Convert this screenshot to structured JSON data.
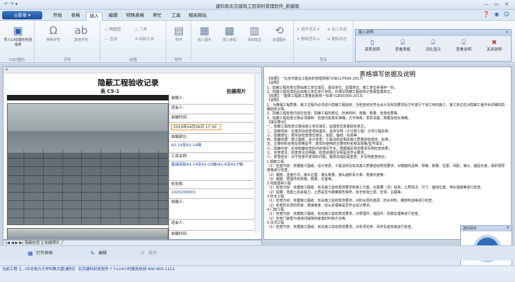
{
  "window": {
    "title": "建科助北京建筑工程资料管理软件_新建版",
    "qat": "↶ ↷ ▾",
    "controls": "— ▭ ✕"
  },
  "menu": {
    "app_button": "◎菜单 ▾",
    "tabs": [
      "开始",
      "表格",
      "插入",
      "编辑",
      "特殊表格",
      "帮忙",
      "工具",
      "相关网站"
    ],
    "active_tab": "插入",
    "help_icons": "❓ ◉ ☺"
  },
  "ribbon": {
    "groups": [
      {
        "label": "CAD图形",
        "buttons": [
          {
            "icon": "cad-icon",
            "glyph": "▣",
            "label": "导入CAD图形检验报表"
          }
        ]
      },
      {
        "label": "字符",
        "buttons": [
          {
            "icon": "omega-icon",
            "glyph": "Ω",
            "label": "特殊字符"
          },
          {
            "icon": "abc-icon",
            "glyph": "ab",
            "label": "其他字符"
          }
        ]
      },
      {
        "label": "绘图",
        "small": [
          "○ 椭圆圆",
          "△ 三角",
          "— 直线",
          "A 绘制文本"
        ]
      },
      {
        "label": "附件",
        "buttons": [
          {
            "icon": "attach-icon",
            "glyph": "▤",
            "label": "附件"
          }
        ]
      },
      {
        "label": "",
        "buttons": [
          {
            "icon": "image-icon",
            "glyph": "▦",
            "label": "插入图片"
          },
          {
            "icon": "qr-icon",
            "glyph": "▩",
            "label": "插入条码"
          },
          {
            "icon": "barcode-icon",
            "glyph": "▥",
            "label": "添加批注"
          },
          {
            "icon": "process-icon",
            "glyph": "⟲",
            "label": "处理图片"
          }
        ]
      },
      {
        "label": "签名",
        "small": [
          "✕ 插件签名 ▾",
          "⊕ 加工状态",
          "✕ 删除签名 ▾",
          "⊖ 删除状态"
        ]
      }
    ]
  },
  "popup_panel": {
    "title": "插入说明",
    "close": "✕",
    "buttons": [
      {
        "icon": "form-icon",
        "glyph": "▯",
        "label": "该表说明"
      },
      {
        "icon": "list-icon",
        "glyph": "⌸",
        "label": "查看表格"
      },
      {
        "icon": "compare-icon",
        "glyph": "⌸",
        "label": "对比显示"
      },
      {
        "icon": "note-icon",
        "glyph": "⌸",
        "label": "查看说明"
      },
      {
        "icon": "close-note-icon",
        "glyph": "✖",
        "label": "关闭说明"
      }
    ]
  },
  "sheet": {
    "row_header": "A",
    "title": "隐蔽工程验收记录",
    "subtitle": "表 C5-1",
    "right_label": "拍摄照片",
    "form_rows": [
      {
        "label": "拍摄人:",
        "value": ""
      },
      {
        "label": "班会人:",
        "value": ""
      },
      {
        "label": "拍摄时间:",
        "value": ""
      },
      {
        "label": "",
        "value": "2019年04月06日  17:30"
      },
      {
        "label": "拍摄部位:",
        "value": ""
      },
      {
        "label": "",
        "value": "A1-14至A1-19轴"
      },
      {
        "label": "工序名称:",
        "value": ""
      },
      {
        "label": "",
        "value": "基础底板A1-14至A1-19轴/A1-A至A1-F轴"
      },
      {
        "label": "检验批:",
        "value": ""
      },
      {
        "label": "",
        "value": "1020206001"
      },
      {
        "label": "拍摄人:",
        "value": ""
      },
      {
        "label": "班会人:",
        "value": ""
      },
      {
        "label": "拍摄时间:",
        "value": ""
      }
    ],
    "sheet_tabs": "|◀ ◀ ▶ ▶| 隐蔽检查 ╳  拍摄照片 ╱"
  },
  "guide": {
    "title": "表格填写依据及说明",
    "lines": [
      "【依据】：\"北京市建设工程资料管理规程\"(DB11/T695-2017)",
      "【说明】",
      "1、隐蔽工程检查记录由施工单位填写，建设单位、监理单位、施工单位各保存一份；",
      "2、隐蔽工程完成后应由施工单位进行自检，并填写隐蔽工程验收记录报监理单位；",
      "【依据】：\"建筑工程施工质量验收统一标准\"(GB50300-2013)",
      "【说明】",
      "1、为确保工程质量，施工过程中必须进行隐蔽工程验收，当检查结论符合设计及规范要求后方可进行下道工序的施工，施工单位应对隐蔽工程作出详细的隐蔽验收记录。",
      "2、隐蔽工程检查内容应包括：隐蔽工程的部位、所用材料、规格、数量、检查结果等。",
      "3、隐蔽工程检查记录必须做到：检查内容真实准确，文字简练，意思清楚，数据及结论准确。",
      "【填写要点】",
      "一、隐蔽工程检查记录由施工单位填写，监理单位签署验收意见；",
      "二、隐蔽项目：应按实际检查项目填写，具体写明（子分部工程）分项工程名称；",
      "三、隐蔽部位：按实际检查部位填写，如层、轴线、标高等；",
      "四、隐蔽依据：施工图纸、设计变更、工程洽商及相关施工质量验收规范、标准；",
      "五、主要材料名称及规格型号：按实际使用的主要材料名称及规格/型号填写；",
      "六、隐蔽内容：应将隐蔽检查的内容填写齐全，根据相关规范要求写明检查结果；",
      "七、检查意见：检查意见应明确，检查结果应写明是否符合要求；",
      "八、复查结论：对于检查中发现的问题，整改完成后需复查，并写明复查结论；",
      "1.钢筋工程",
      "（1）检查内容：依据施工图纸、设计变更、工程洽商及有关施工质量验收规范要求，对钢筋的品种、规格、数量、位置、间距、接头、锚固长度、保护层厚度等进行检查。",
      "（2）钢筋：连接方式、接头位置、接头数量、接头面积百分率、搭接长度等。",
      "（3）钢筋：预埋件的规格、数量、位置等。",
      "2.地基基础工程",
      "（1）检查内容：依据施工图纸、有关施工验收规范要求和施工方案，对基槽（坑）标高、土质情况、尺寸、轴线位置、排水措施等进行检查。",
      "（2）验槽：地基土的承载力、土质是否与勘察报告相符，有无软弱土层、空洞、古墓等。",
      "3.防水工程",
      "（1）检查内容：依据施工图纸、有关施工验收规范要求，对防水层的基层、防水材料、细部构造等进行检查。",
      "（2）检查防水层的厚度、搭接宽度、收头处理等是否符合设计要求。",
      "4.门窗工程",
      "（1）检查内容：依据施工图纸、有关施工验收规范要求，对预埋件、锚固件、防腐处理等进行检查。",
      "（2）检查门窗框与墙体间缝隙的嵌填材料和方法等。",
      "5.吊顶工程",
      "（1）检查内容：依据施工图纸、有关施工验收规范要求，对吊顶龙骨、吊杆及其安装进行检查。"
    ]
  },
  "logo_window": {
    "title": "建科助手",
    "close": "✕",
    "mark": "JKY"
  },
  "bottom_buttons": [
    {
      "icon": "table-icon",
      "glyph": "▦",
      "label": "打开表格"
    },
    {
      "icon": "edit-icon",
      "glyph": "✎",
      "label": "编辑"
    },
    {
      "icon": "undo-icon",
      "glyph": "↺",
      "label": "撤销"
    }
  ],
  "statusbar": "当前工程【...\\中北电力大学科教大厦\\建科】 北京建科研发软件 ? 7×24小时服务热线 400-855-1113"
}
